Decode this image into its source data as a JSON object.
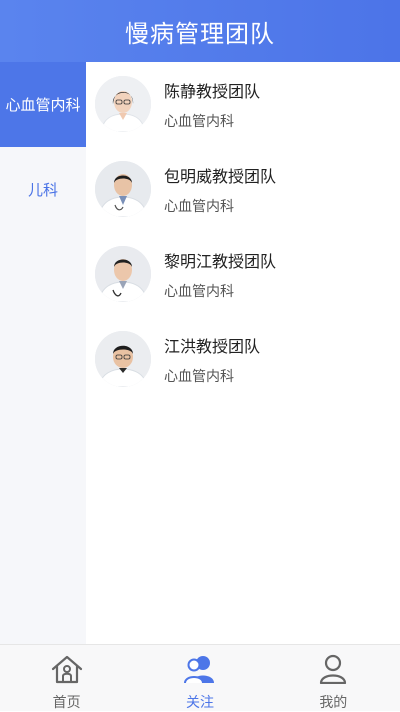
{
  "header": {
    "title": "慢病管理团队"
  },
  "sidebar": {
    "items": [
      {
        "label": "心血管内科",
        "active": true
      },
      {
        "label": "儿科",
        "active": false
      }
    ]
  },
  "teams": [
    {
      "name": "陈静教授团队",
      "department": "心血管内科"
    },
    {
      "name": "包明威教授团队",
      "department": "心血管内科"
    },
    {
      "name": "黎明江教授团队",
      "department": "心血管内科"
    },
    {
      "name": "江洪教授团队",
      "department": "心血管内科"
    }
  ],
  "tabbar": {
    "tabs": [
      {
        "label": "首页",
        "icon": "home-icon"
      },
      {
        "label": "关注",
        "icon": "follow-icon"
      },
      {
        "label": "我的",
        "icon": "profile-icon"
      }
    ],
    "active_color": "#4d76e8"
  },
  "colors": {
    "accent": "#4d76e8"
  }
}
